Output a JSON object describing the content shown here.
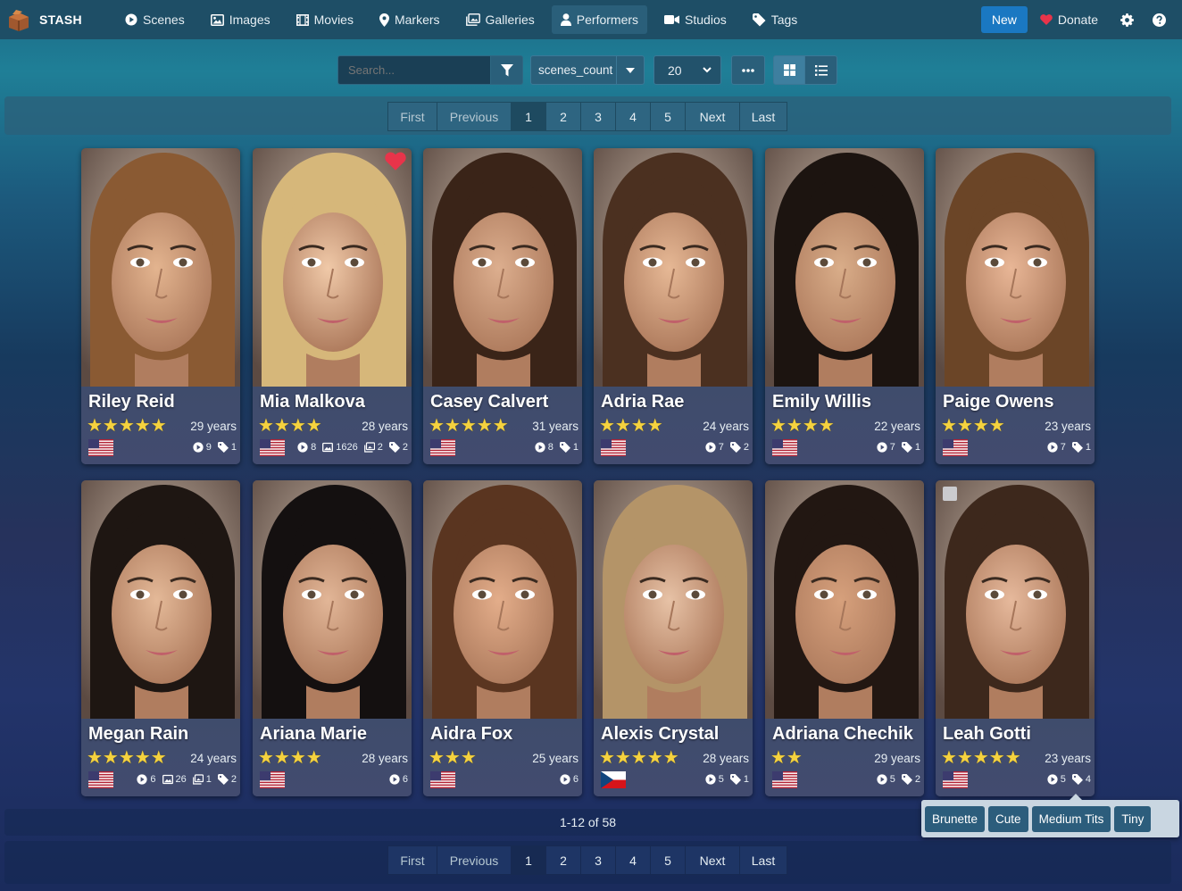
{
  "nav": {
    "brand": "STASH",
    "items": [
      {
        "label": "Scenes",
        "icon": "play-circle-icon"
      },
      {
        "label": "Images",
        "icon": "image-icon"
      },
      {
        "label": "Movies",
        "icon": "film-icon"
      },
      {
        "label": "Markers",
        "icon": "map-marker-icon"
      },
      {
        "label": "Galleries",
        "icon": "images-icon"
      },
      {
        "label": "Performers",
        "icon": "user-icon",
        "active": true
      },
      {
        "label": "Studios",
        "icon": "video-icon"
      },
      {
        "label": "Tags",
        "icon": "tag-icon"
      }
    ],
    "new_label": "New",
    "donate_label": "Donate"
  },
  "toolbar": {
    "search_placeholder": "Search...",
    "sort_by": "scenes_count",
    "per_page": "20"
  },
  "pagination": {
    "first": "First",
    "previous": "Previous",
    "pages": [
      "1",
      "2",
      "3",
      "4",
      "5"
    ],
    "current": "1",
    "next": "Next",
    "last": "Last"
  },
  "performers": [
    {
      "name": "Riley Reid",
      "rating": 5,
      "stars": "★★★★★",
      "age": "29 years",
      "flag": "us",
      "favorite": false,
      "meta": [
        {
          "icon": "play-icon",
          "value": "9"
        },
        {
          "icon": "tag-icon",
          "value": "1"
        }
      ]
    },
    {
      "name": "Mia Malkova",
      "rating": 4,
      "stars": "★★★★",
      "age": "28 years",
      "flag": "us",
      "favorite": true,
      "meta": [
        {
          "icon": "play-icon",
          "value": "8"
        },
        {
          "icon": "image-icon",
          "value": "1626"
        },
        {
          "icon": "images-icon",
          "value": "2"
        },
        {
          "icon": "tag-icon",
          "value": "2"
        }
      ]
    },
    {
      "name": "Casey Calvert",
      "rating": 5,
      "stars": "★★★★★",
      "age": "31 years",
      "flag": "us",
      "favorite": false,
      "meta": [
        {
          "icon": "play-icon",
          "value": "8"
        },
        {
          "icon": "tag-icon",
          "value": "1"
        }
      ]
    },
    {
      "name": "Adria Rae",
      "rating": 4,
      "stars": "★★★★",
      "age": "24 years",
      "flag": "us",
      "favorite": false,
      "meta": [
        {
          "icon": "play-icon",
          "value": "7"
        },
        {
          "icon": "tag-icon",
          "value": "2"
        }
      ]
    },
    {
      "name": "Emily Willis",
      "rating": 4,
      "stars": "★★★★",
      "age": "22 years",
      "flag": "us",
      "favorite": false,
      "meta": [
        {
          "icon": "play-icon",
          "value": "7"
        },
        {
          "icon": "tag-icon",
          "value": "1"
        }
      ]
    },
    {
      "name": "Paige Owens",
      "rating": 4,
      "stars": "★★★★",
      "age": "23 years",
      "flag": "us",
      "favorite": false,
      "meta": [
        {
          "icon": "play-icon",
          "value": "7"
        },
        {
          "icon": "tag-icon",
          "value": "1"
        }
      ]
    },
    {
      "name": "Megan Rain",
      "rating": 5,
      "stars": "★★★★★",
      "age": "24 years",
      "flag": "us",
      "favorite": false,
      "meta": [
        {
          "icon": "play-icon",
          "value": "6"
        },
        {
          "icon": "image-icon",
          "value": "26"
        },
        {
          "icon": "images-icon",
          "value": "1"
        },
        {
          "icon": "tag-icon",
          "value": "2"
        }
      ]
    },
    {
      "name": "Ariana Marie",
      "rating": 4,
      "stars": "★★★★",
      "age": "28 years",
      "flag": "us",
      "favorite": false,
      "meta": [
        {
          "icon": "play-icon",
          "value": "6"
        }
      ]
    },
    {
      "name": "Aidra Fox",
      "rating": 3,
      "stars": "★★★",
      "age": "25 years",
      "flag": "us",
      "favorite": false,
      "meta": [
        {
          "icon": "play-icon",
          "value": "6"
        }
      ]
    },
    {
      "name": "Alexis Crystal",
      "rating": 5,
      "stars": "★★★★★",
      "age": "28 years",
      "flag": "cz",
      "favorite": false,
      "meta": [
        {
          "icon": "play-icon",
          "value": "5"
        },
        {
          "icon": "tag-icon",
          "value": "1"
        }
      ]
    },
    {
      "name": "Adriana Chechik",
      "rating": 2,
      "stars": "★★",
      "age": "29 years",
      "flag": "us",
      "favorite": false,
      "meta": [
        {
          "icon": "play-icon",
          "value": "5"
        },
        {
          "icon": "tag-icon",
          "value": "2"
        }
      ]
    },
    {
      "name": "Leah Gotti",
      "rating": 5,
      "stars": "★★★★★",
      "age": "23 years",
      "flag": "us",
      "favorite": false,
      "selectable": true,
      "meta": [
        {
          "icon": "play-icon",
          "value": "5"
        },
        {
          "icon": "tag-icon",
          "value": "4"
        }
      ]
    }
  ],
  "result_count": "1-12 of 58",
  "tag_popover": [
    "Brunette",
    "Cute",
    "Medium Tits",
    "Tiny"
  ],
  "colors": {
    "navbar": "#1e4e66",
    "primary": "#1a78c2",
    "star": "#f5d23f",
    "heart": "#e8344a"
  }
}
